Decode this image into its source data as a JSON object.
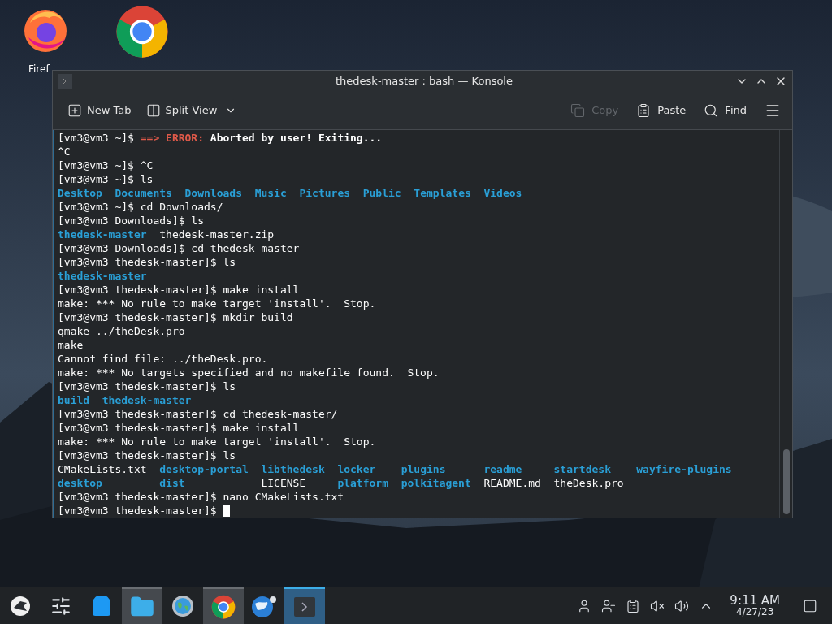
{
  "desktop_icons": [
    {
      "kind": "firefox",
      "label": "Firef"
    },
    {
      "kind": "chrome"
    }
  ],
  "window": {
    "title": "thedesk-master : bash — Konsole"
  },
  "toolbar": {
    "left": [
      {
        "kind": "new-tab",
        "label": "New Tab",
        "disabled": false
      },
      {
        "kind": "split-view",
        "label": "Split View",
        "disabled": false
      }
    ],
    "right": [
      {
        "kind": "copy",
        "label": "Copy",
        "disabled": true
      },
      {
        "kind": "paste",
        "label": "Paste",
        "disabled": false
      },
      {
        "kind": "find",
        "label": "Find",
        "disabled": false
      }
    ]
  },
  "terminal": {
    "cursor_visible": true,
    "lines": [
      [
        {
          "text": "[vm3@vm3 ~]$ ",
          "kind": "plain"
        },
        {
          "text": "==> ERROR:",
          "kind": "error"
        },
        {
          "text": " Aborted by user! Exiting...",
          "kind": "bold"
        }
      ],
      [
        {
          "text": "^C",
          "kind": "plain"
        }
      ],
      [
        {
          "text": "[vm3@vm3 ~]$ ^C",
          "kind": "plain"
        }
      ],
      [
        {
          "text": "[vm3@vm3 ~]$ ls",
          "kind": "plain"
        }
      ],
      [
        {
          "text": "Desktop  ",
          "kind": "dir"
        },
        {
          "text": "Documents  ",
          "kind": "dir"
        },
        {
          "text": "Downloads  ",
          "kind": "dir"
        },
        {
          "text": "Music  ",
          "kind": "dir"
        },
        {
          "text": "Pictures  ",
          "kind": "dir"
        },
        {
          "text": "Public  ",
          "kind": "dir"
        },
        {
          "text": "Templates  ",
          "kind": "dir"
        },
        {
          "text": "Videos",
          "kind": "dir"
        }
      ],
      [
        {
          "text": "[vm3@vm3 ~]$ cd Downloads/",
          "kind": "plain"
        }
      ],
      [
        {
          "text": "[vm3@vm3 Downloads]$ ls",
          "kind": "plain"
        }
      ],
      [
        {
          "text": "thedesk-master  ",
          "kind": "dir"
        },
        {
          "text": "thedesk-master.zip",
          "kind": "plain"
        }
      ],
      [
        {
          "text": "[vm3@vm3 Downloads]$ cd thedesk-master",
          "kind": "plain"
        }
      ],
      [
        {
          "text": "[vm3@vm3 thedesk-master]$ ls",
          "kind": "plain"
        }
      ],
      [
        {
          "text": "thedesk-master",
          "kind": "dir"
        }
      ],
      [
        {
          "text": "[vm3@vm3 thedesk-master]$ make install",
          "kind": "plain"
        }
      ],
      [
        {
          "text": "make: *** No rule to make target 'install'.  Stop.",
          "kind": "plain"
        }
      ],
      [
        {
          "text": "[vm3@vm3 thedesk-master]$ mkdir build",
          "kind": "plain"
        }
      ],
      [
        {
          "text": "qmake ../theDesk.pro",
          "kind": "plain"
        }
      ],
      [
        {
          "text": "make",
          "kind": "plain"
        }
      ],
      [
        {
          "text": "Cannot find file: ../theDesk.pro.",
          "kind": "plain"
        }
      ],
      [
        {
          "text": "make: *** No targets specified and no makefile found.  Stop.",
          "kind": "plain"
        }
      ],
      [
        {
          "text": "[vm3@vm3 thedesk-master]$ ls",
          "kind": "plain"
        }
      ],
      [
        {
          "text": "build  ",
          "kind": "dir"
        },
        {
          "text": "thedesk-master",
          "kind": "dir"
        }
      ],
      [
        {
          "text": "[vm3@vm3 thedesk-master]$ cd thedesk-master/",
          "kind": "plain"
        }
      ],
      [
        {
          "text": "[vm3@vm3 thedesk-master]$ make install",
          "kind": "plain"
        }
      ],
      [
        {
          "text": "make: *** No rule to make target 'install'.  Stop.",
          "kind": "plain"
        }
      ],
      [
        {
          "text": "[vm3@vm3 thedesk-master]$ ls",
          "kind": "plain"
        }
      ],
      [
        {
          "text": "CMakeLists.txt  ",
          "kind": "plain"
        },
        {
          "text": "desktop-portal  ",
          "kind": "dir"
        },
        {
          "text": "libthedesk  ",
          "kind": "dir"
        },
        {
          "text": "locker    ",
          "kind": "dir"
        },
        {
          "text": "plugins      ",
          "kind": "dir"
        },
        {
          "text": "readme     ",
          "kind": "dir"
        },
        {
          "text": "startdesk    ",
          "kind": "dir"
        },
        {
          "text": "wayfire-plugins",
          "kind": "dir"
        }
      ],
      [
        {
          "text": "desktop         ",
          "kind": "dir"
        },
        {
          "text": "dist            ",
          "kind": "dir"
        },
        {
          "text": "LICENSE     ",
          "kind": "plain"
        },
        {
          "text": "platform  ",
          "kind": "dir"
        },
        {
          "text": "polkitagent  ",
          "kind": "dir"
        },
        {
          "text": "README.md  ",
          "kind": "plain"
        },
        {
          "text": "theDesk.pro",
          "kind": "plain"
        }
      ],
      [
        {
          "text": "[vm3@vm3 thedesk-master]$ nano CMakeLists.txt",
          "kind": "plain"
        }
      ],
      [
        {
          "text": "[vm3@vm3 thedesk-master]$ ",
          "kind": "plain"
        }
      ]
    ]
  },
  "taskbar": {
    "items": [
      {
        "kind": "launcher",
        "open": false,
        "active": false
      },
      {
        "kind": "sliders",
        "open": false,
        "active": false
      },
      {
        "kind": "store",
        "open": false,
        "active": false
      },
      {
        "kind": "files",
        "open": true,
        "active": false
      },
      {
        "kind": "settings",
        "open": false,
        "active": false
      },
      {
        "kind": "chrome",
        "open": true,
        "active": false
      },
      {
        "kind": "mail",
        "open": false,
        "active": false
      },
      {
        "kind": "konsole",
        "open": true,
        "active": true
      }
    ],
    "tray": [
      {
        "kind": "user"
      },
      {
        "kind": "user-minus"
      },
      {
        "kind": "clipboard"
      },
      {
        "kind": "muted"
      },
      {
        "kind": "volume"
      },
      {
        "kind": "caret"
      }
    ],
    "time": "9:11 AM",
    "date": "4/27/23"
  }
}
